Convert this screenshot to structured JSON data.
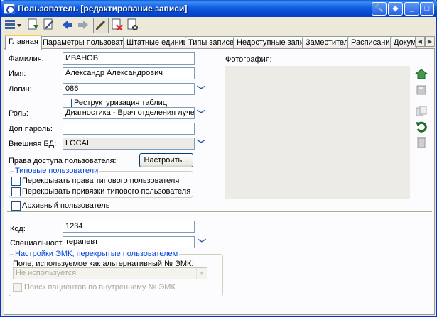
{
  "window": {
    "title": "Пользователь [редактирование записи]"
  },
  "titlebar_buttons": [
    "🔧",
    "◆",
    "_",
    "□",
    "✕"
  ],
  "tabs": [
    "Главная",
    "Параметры пользователя",
    "Штатные единицы",
    "Типы записей",
    "Недоступные записи",
    "Заместители",
    "Расписания",
    "Докуме"
  ],
  "form": {
    "surname_label": "Фамилия:",
    "surname_value": "ИВАНОВ",
    "name_label": "Имя:",
    "name_value": "Александр Александрович",
    "login_label": "Логин:",
    "login_value": "086",
    "restructure_label": "Реструктуризация таблиц",
    "role_label": "Роль:",
    "role_value": "Диагностика - Врач отделения лучевой диа",
    "extra_password_label": "Доп пароль:",
    "extra_password_value": "",
    "external_db_label": "Внешняя БД:",
    "external_db_value": "LOCAL",
    "access_rights_label": "Права доступа пользователя:",
    "configure_button": "Настроить...",
    "typical_users_group": "Типовые пользователи",
    "override_rights_label": "Перекрывать права типового пользователя",
    "override_bindings_label": "Перекрывать привязки типового пользователя",
    "archive_user_label": "Архивный пользователь",
    "photo_label": "Фотография:",
    "code_label": "Код:",
    "code_value": "1234",
    "speciality_label": "Специальность:",
    "speciality_value": "терапевт",
    "emk_group": "Настройки ЭМК, перекрытые пользователем",
    "alt_field_label": "Поле, используемое как альтернативный № ЭМК:",
    "alt_field_value": "Не используется",
    "search_internal_label": "Поиск пациентов по внутреннему № ЭМК"
  }
}
